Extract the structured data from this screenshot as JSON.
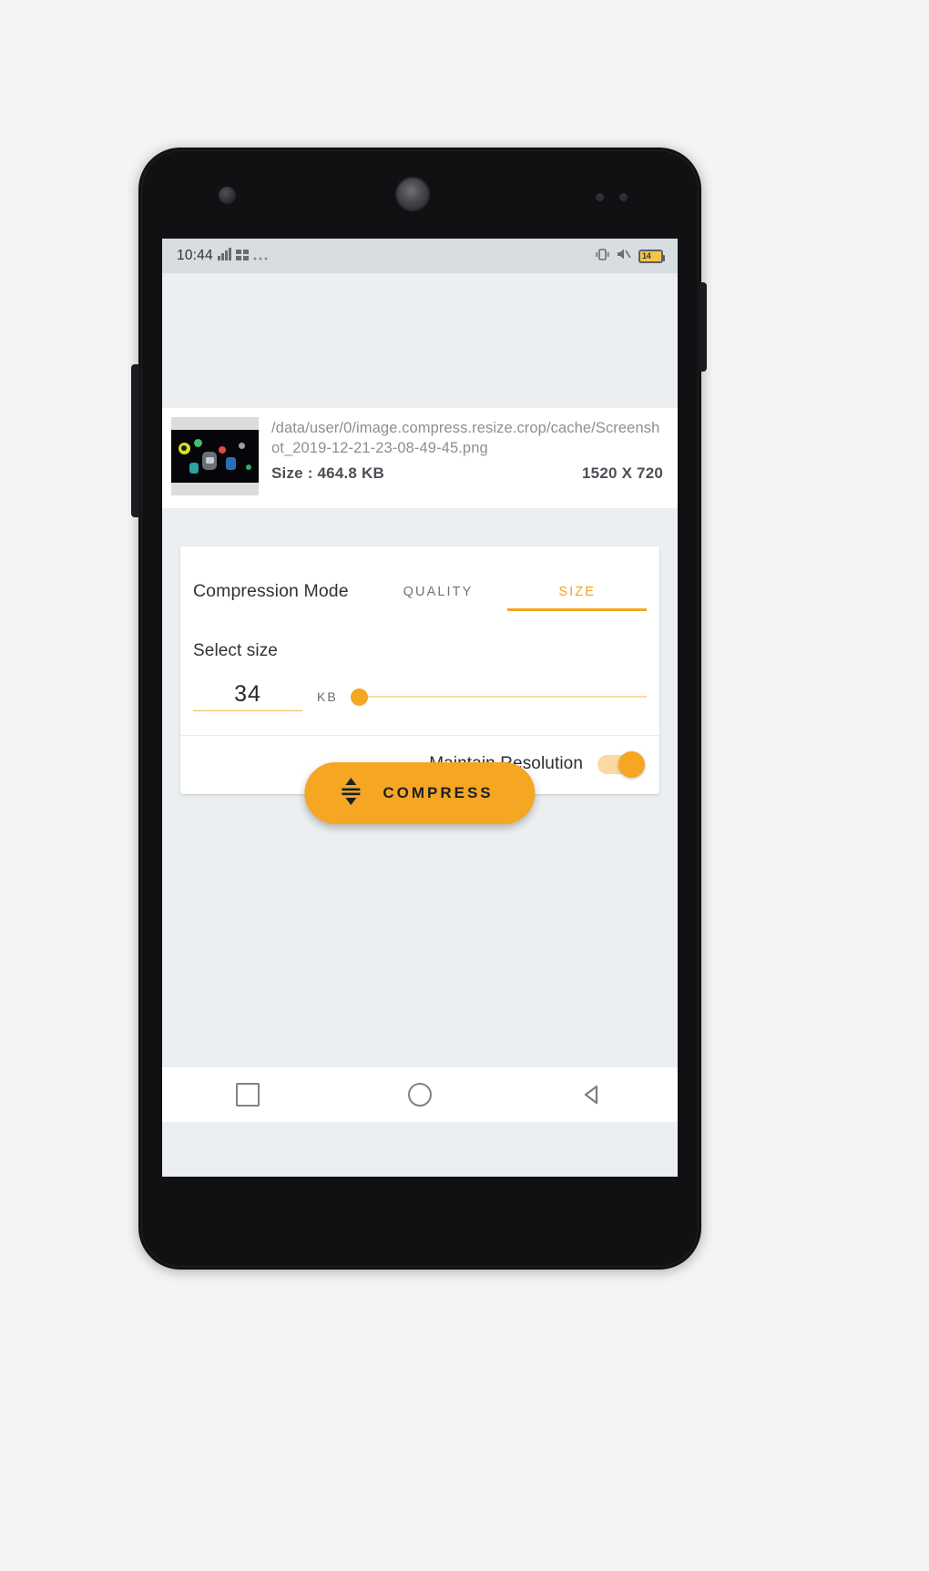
{
  "status_bar": {
    "time": "10:44",
    "left_icons": [
      "signal-icon",
      "network-icon",
      "more-icon"
    ],
    "right_icons": [
      "vibrate-icon",
      "mute-icon"
    ],
    "battery_level": "14"
  },
  "file_info": {
    "path": "/data/user/0/image.compress.resize.crop/cache/Screenshot_2019-12-21-23-08-49-45.png",
    "size_label": "Size : 464.8 KB",
    "resolution": "1520 X 720",
    "thumbnail_name": "image-thumbnail"
  },
  "compression": {
    "mode_label": "Compression Mode",
    "tabs": [
      {
        "label": "QUALITY",
        "active": false
      },
      {
        "label": "SIZE",
        "active": true
      }
    ],
    "select_size_label": "Select size",
    "size_value": "34",
    "size_unit": "KB",
    "slider": {
      "value": 0,
      "min": 0,
      "max": 100
    },
    "maintain_resolution_label": "Maintain Resolution",
    "maintain_resolution_on": true,
    "compress_button_label": "COMPRESS"
  },
  "nav_bar": {
    "buttons": [
      "recents-square-icon",
      "home-circle-icon",
      "back-triangle-icon"
    ]
  },
  "colors": {
    "accent": "#f5a623",
    "accent_light": "#fbd9a3",
    "screen_bg": "#eceff1",
    "card_bg": "#ffffff",
    "status_bar_bg": "#d7dde1",
    "text_primary": "#2f3336",
    "text_muted": "#8b8f93"
  }
}
